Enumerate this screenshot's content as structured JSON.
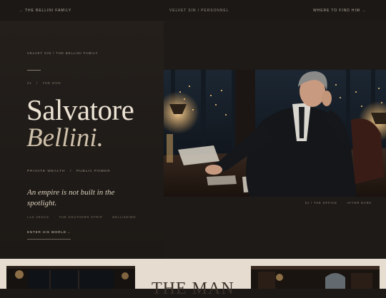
{
  "nav": {
    "left": "← The Bellini Family",
    "center": "Velvet Sin / Personnel",
    "right": "Where to find him →"
  },
  "hero": {
    "eyebrow": "Velvet Sin / The Bellini Family",
    "index": "01   /   The Don",
    "first_name": "Salvatore",
    "last_name": "Bellini.",
    "meta": "Private Wealth   /   Public Power",
    "tagline": "An empire is not built in the spotlight.",
    "places": "Las Vegas   ·   The Southern Strip   ·   Bellissimo",
    "cta_label": "Enter his world",
    "cta_arrow": "→",
    "photo_caption": "01 / The Office   ·   After Dark"
  },
  "lower": {
    "title": "The Man"
  },
  "colors": {
    "background": "#1c1917",
    "accent_cream": "#e9e0d2",
    "muted": "#9c907f",
    "lower_bg": "#e6ddd0"
  }
}
